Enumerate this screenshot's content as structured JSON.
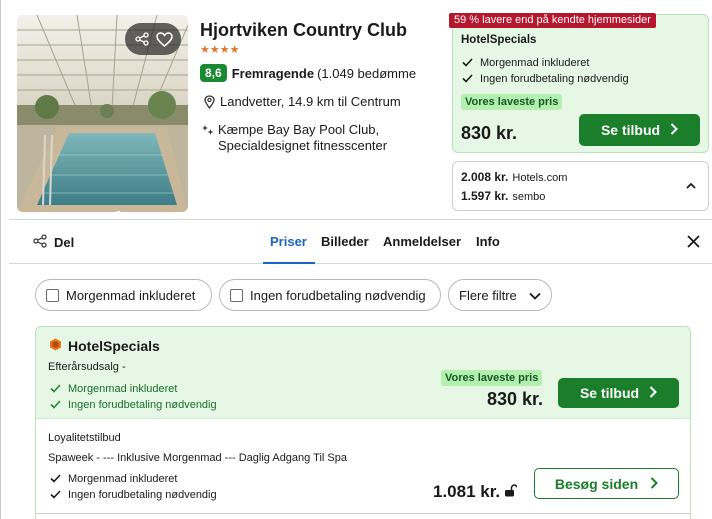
{
  "hotel": {
    "name": "Hjortviken Country Club",
    "stars": "★★★★",
    "score": "8,6",
    "score_label": "Fremragende",
    "reviews": "(1.049 bedømmelser)",
    "location": "Landvetter, 14.9 km til Centrum",
    "facilities": "Kæmpe Bay Bay Pool Club, Specialdesignet fitnesscenter"
  },
  "featured_deal": {
    "ribbon": "59 % lavere end på kendte hjemmesider",
    "provider": "HotelSpecials",
    "perks": [
      "Morgenmad inkluderet",
      "Ingen forudbetaling nødvendig"
    ],
    "badge": "Vores laveste pris",
    "price": "830 kr.",
    "button": "Se tilbud"
  },
  "other_prices": [
    {
      "price": "2.008 kr.",
      "site": "Hotels.com"
    },
    {
      "price": "1.597 kr.",
      "site": "sembo"
    }
  ],
  "tabs": {
    "share": "Del",
    "items": [
      "Priser",
      "Billeder",
      "Anmeldelser",
      "Info"
    ],
    "active": "Priser"
  },
  "filters": [
    "Morgenmad inkluderet",
    "Ingen forudbetaling nødvendig",
    "Flere filtre"
  ],
  "offers": [
    {
      "provider": "HotelSpecials",
      "subtitle": "Efterårsudsalg -",
      "perks": [
        "Morgenmad inkluderet",
        "Ingen forudbetaling nødvendig"
      ],
      "badge": "Vores laveste pris",
      "price": "830 kr.",
      "button": "Se tilbud"
    },
    {
      "provider": "Loyalitetstilbud",
      "subtitle": "Spaweek - --- Inklusive Morgenmad --- Daglig Adgang Til Spa",
      "perks": [
        "Morgenmad inkluderet",
        "Ingen forudbetaling nødvendig"
      ],
      "price": "1.081 kr.",
      "button": "Besøg siden"
    }
  ],
  "colors": {
    "accent_green": "#1a7e2a",
    "deal_bg": "#e6f7e6",
    "ribbon_red": "#b5172f",
    "score_green": "#1a8a32",
    "tab_blue": "#1c64c4",
    "star_orange": "#e0762b"
  }
}
